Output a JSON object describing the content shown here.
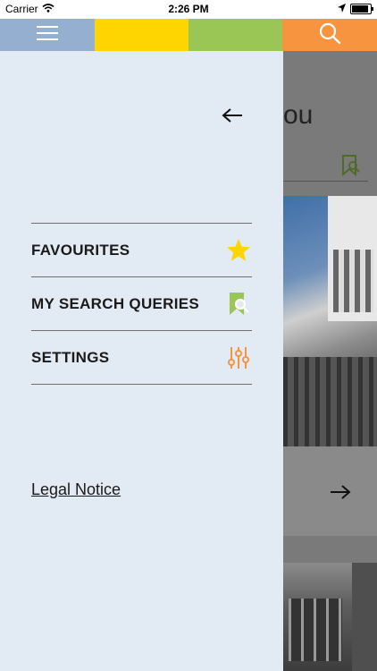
{
  "status_bar": {
    "carrier": "Carrier",
    "time": "2:26 PM"
  },
  "top_bar": {
    "colors": {
      "menu": "#95afd0",
      "yellow": "#fed500",
      "green": "#9ac656",
      "orange": "#f6943f"
    },
    "icons": [
      "hamburger-menu-icon",
      "search-icon"
    ]
  },
  "background": {
    "title_fragment": "ou"
  },
  "drawer": {
    "menu": [
      {
        "label": "FAVOURITES",
        "icon": "star-icon",
        "icon_color": "#fed500"
      },
      {
        "label": "MY SEARCH QUERIES",
        "icon": "bookmark-search-icon",
        "icon_color": "#9ac656"
      },
      {
        "label": "SETTINGS",
        "icon": "sliders-icon",
        "icon_color": "#f6943f"
      }
    ],
    "legal_label": "Legal Notice"
  }
}
